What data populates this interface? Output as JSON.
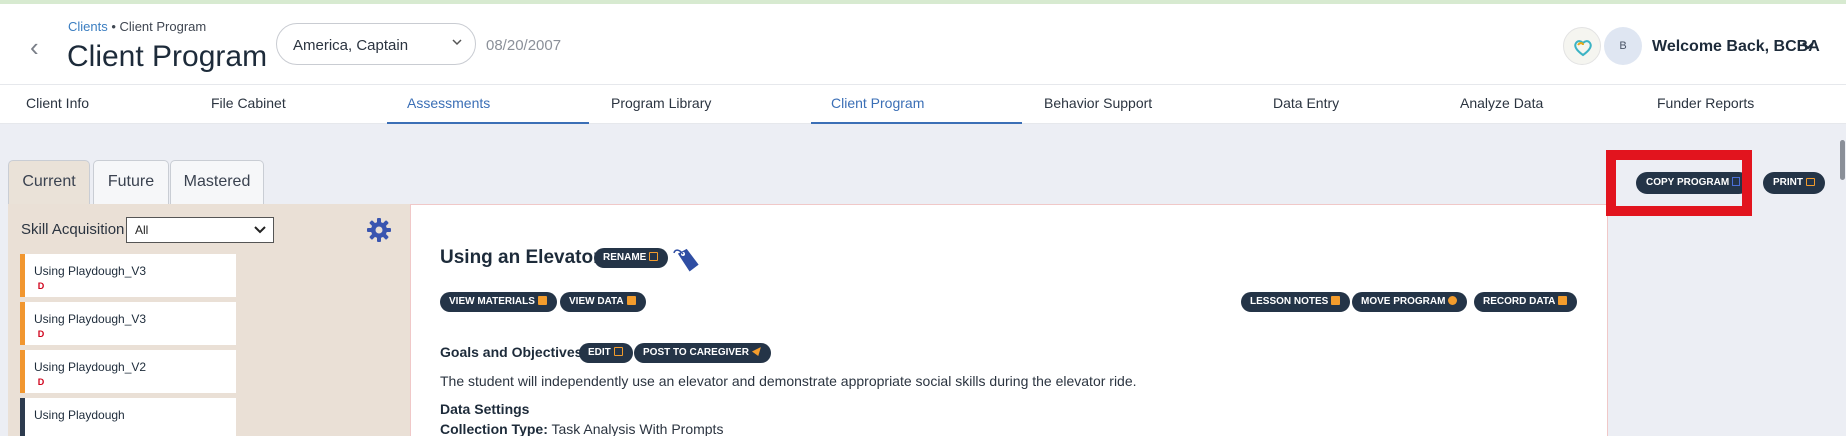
{
  "breadcrumb": {
    "parent": "Clients",
    "separator": " • ",
    "current": "Client Program"
  },
  "page_title": "Client Program",
  "client_select": {
    "value": "America, Captain"
  },
  "client_dob": "08/20/2007",
  "user": {
    "avatar_initial": "B",
    "welcome": "Welcome Back, BCBA"
  },
  "nav": {
    "tabs": [
      {
        "label": "Client Info"
      },
      {
        "label": "File Cabinet"
      },
      {
        "label": "Assessments"
      },
      {
        "label": "Program Library"
      },
      {
        "label": "Client Program"
      },
      {
        "label": "Behavior Support"
      },
      {
        "label": "Data Entry"
      },
      {
        "label": "Analyze Data"
      },
      {
        "label": "Funder Reports"
      }
    ]
  },
  "subtabs": [
    {
      "label": "Current"
    },
    {
      "label": "Future"
    },
    {
      "label": "Mastered"
    }
  ],
  "left_panel": {
    "skill_label": "Skill Acquisition",
    "filter_value": "All",
    "programs": [
      {
        "name": "Using Playdough_V3",
        "badge": "D"
      },
      {
        "name": "Using Playdough_V3",
        "badge": "D"
      },
      {
        "name": "Using Playdough_V2",
        "badge": "D"
      },
      {
        "name": "Using Playdough",
        "badge": ""
      }
    ]
  },
  "lesson": {
    "title": "Using an Elevator",
    "rename": "RENAME",
    "buttons": {
      "view_materials": "VIEW MATERIALS",
      "view_data": "VIEW DATA",
      "lesson_notes": "LESSON NOTES",
      "move_program": "MOVE PROGRAM",
      "record_data": "RECORD DATA"
    },
    "goals_label": "Goals and Objectives",
    "edit": "EDIT",
    "post_to_caregiver": "POST TO CAREGIVER",
    "goal_text": "The student will independently use an elevator and demonstrate appropriate social skills during the elevator ride.",
    "data_settings_label": "Data Settings",
    "collection_type_label": "Collection Type:",
    "collection_type_value": "Task Analysis With Prompts"
  },
  "actions": {
    "copy_program": "COPY PROGRAM",
    "print": "PRINT"
  },
  "colors": {
    "accent": "#3b6fb6",
    "button_dark": "#243447",
    "icon_orange": "#f39c2c",
    "highlight": "#e2141e"
  }
}
